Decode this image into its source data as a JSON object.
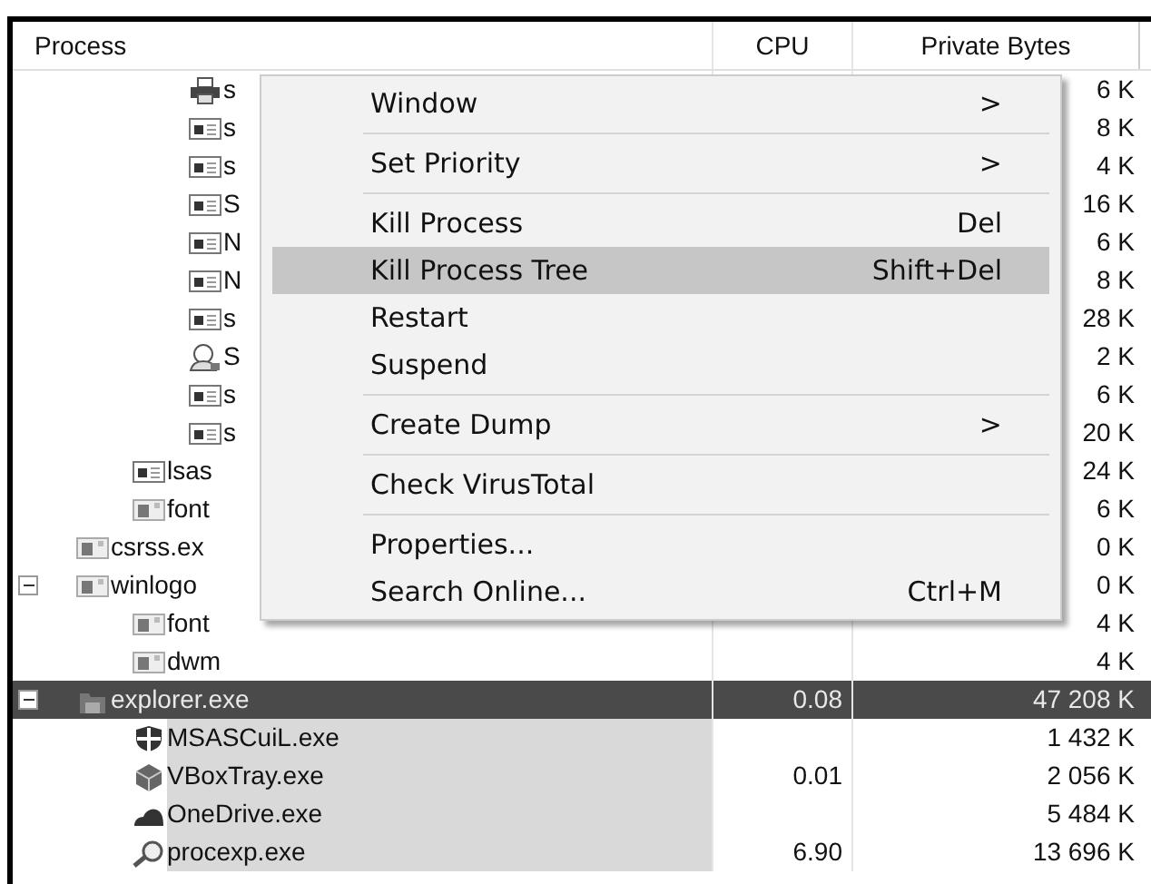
{
  "columns": [
    {
      "label": "Process"
    },
    {
      "label": "CPU"
    },
    {
      "label": "Private Bytes"
    }
  ],
  "processes": [
    {
      "children": [
        {
          "children": [
            {
              "kind": "printer",
              "name": "s",
              "private_bytes": "6 K",
              "selected": false
            },
            {
              "kind": "window",
              "name": "s",
              "private_bytes": "8 K",
              "selected": false
            },
            {
              "kind": "window",
              "name": "s",
              "private_bytes": "4 K",
              "selected": false
            },
            {
              "kind": "window",
              "name": "S",
              "private_bytes": "16 K",
              "selected": false
            },
            {
              "kind": "window",
              "name": "N",
              "private_bytes": "6 K",
              "selected": false
            },
            {
              "kind": "window",
              "name": "N",
              "private_bytes": "8 K",
              "selected": false
            },
            {
              "kind": "window",
              "name": "s",
              "private_bytes": "28 K",
              "selected": false
            },
            {
              "kind": "service",
              "name": "S",
              "private_bytes": "2 K",
              "selected": false
            },
            {
              "kind": "window",
              "name": "s",
              "private_bytes": "6 K",
              "selected": false
            },
            {
              "kind": "window",
              "name": "s",
              "private_bytes": "20 K",
              "selected": false
            }
          ]
        },
        {
          "kind": "window",
          "name": "lsas",
          "private_bytes": "24 K",
          "selected": false
        },
        {
          "kind": "exe",
          "name": "font",
          "private_bytes": "6 K",
          "selected": false
        }
      ]
    },
    {
      "kind": "exe",
      "name": "csrss.ex",
      "private_bytes": "0 K",
      "selected": false
    },
    {
      "kind": "exe",
      "name": "winlogo",
      "private_bytes": "0 K",
      "selected": false,
      "expanded": true,
      "children": [
        {
          "kind": "exe",
          "name": "font",
          "private_bytes": "4 K",
          "selected": false
        },
        {
          "kind": "exe",
          "name": "dwm",
          "private_bytes": "4 K",
          "selected": false
        }
      ]
    },
    {
      "kind": "folder",
      "name": "explorer.exe",
      "cpu": "0.08",
      "private_bytes": "47 208 K",
      "selected": true,
      "expanded": true,
      "children": [
        {
          "kind": "shield",
          "name": "MSASCuiL.exe",
          "private_bytes": "1 432 K",
          "selected": false,
          "color": "#d9d9d9"
        },
        {
          "kind": "box",
          "name": "VBoxTray.exe",
          "cpu": "0.01",
          "private_bytes": "2 056 K",
          "selected": false,
          "color": "#d9d9d9"
        },
        {
          "kind": "cloud",
          "name": "OneDrive.exe",
          "private_bytes": "5 484 K",
          "selected": false,
          "color": "#d9d9d9"
        },
        {
          "kind": "magnifier",
          "name": "procexp.exe",
          "cpu": "6.90",
          "private_bytes": "13 696 K",
          "selected": false,
          "color": "#d9d9d9"
        }
      ]
    }
  ],
  "context_menu": [
    {
      "kind": "item",
      "label": "Window",
      "arrow": ">",
      "selected": false
    },
    {
      "kind": "separator"
    },
    {
      "kind": "item",
      "label": "Set Priority",
      "arrow": ">",
      "selected": false
    },
    {
      "kind": "separator"
    },
    {
      "kind": "item",
      "label": "Kill Process",
      "shortcut": "Del",
      "selected": false
    },
    {
      "kind": "item",
      "label": "Kill Process Tree",
      "shortcut": "Shift+Del",
      "selected": true
    },
    {
      "kind": "item",
      "label": "Restart",
      "selected": false
    },
    {
      "kind": "item",
      "label": "Suspend",
      "selected": false
    },
    {
      "kind": "separator"
    },
    {
      "kind": "item",
      "label": "Create Dump",
      "arrow": ">",
      "selected": false
    },
    {
      "kind": "separator"
    },
    {
      "kind": "item",
      "label": "Check VirusTotal",
      "selected": false
    },
    {
      "kind": "separator"
    },
    {
      "kind": "item",
      "label": "Properties...",
      "selected": false
    },
    {
      "kind": "item",
      "label": "Search Online...",
      "shortcut": "Ctrl+M",
      "selected": false
    }
  ]
}
